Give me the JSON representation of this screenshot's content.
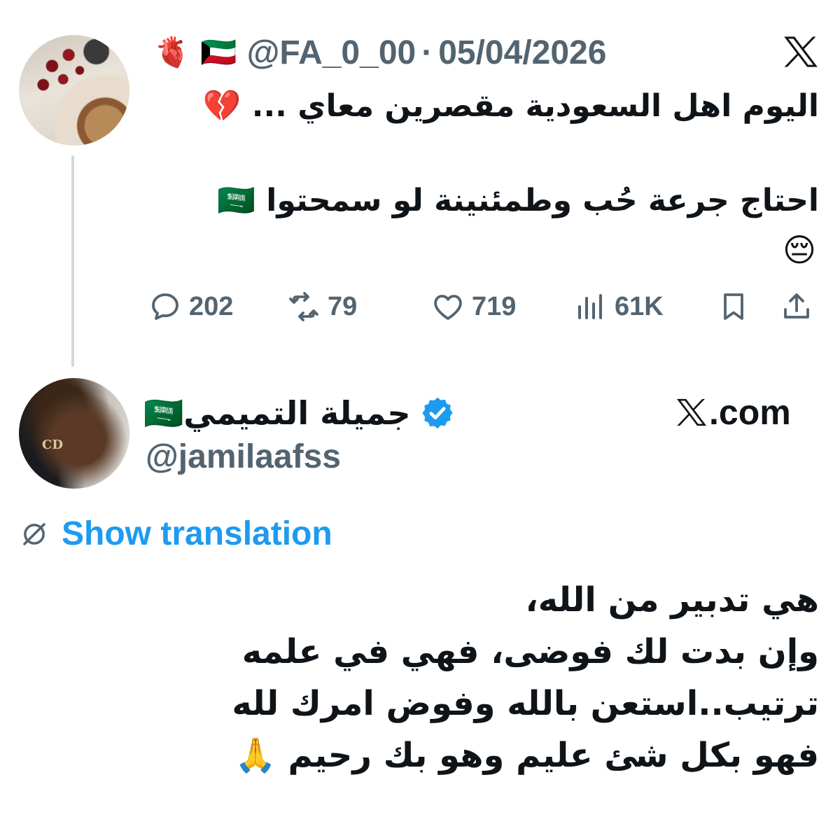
{
  "tweet1": {
    "header_emojis": [
      "🫀",
      "🇰🇼"
    ],
    "handle": "@FA_0_00",
    "separator": "·",
    "date": "05/04/2026",
    "line1": "اليوم اهل السعودية مقصرين معاي ... 💔",
    "line2": "احتاج جرعة حُب وطمئنينة لو سمحتوا 🇸🇦",
    "line3": "😔",
    "actions": {
      "replies": "202",
      "reposts": "79",
      "likes": "719",
      "views": "61K"
    }
  },
  "tweet2": {
    "display_name": "جميلة التميمي🇸🇦",
    "handle": "@jamilaafss",
    "site": ".com",
    "show_translation": "Show translation",
    "avatar_mark": "CD",
    "lines": [
      "هي تدبير من الله،",
      "وإن بدت لك فوضى، فهي في علمه",
      "ترتيب..استعن بالله وفوض امرك لله",
      "فهو بكل شئ عليم وهو بك رحيم 🙏"
    ]
  },
  "colors": {
    "text": "#0f1419",
    "muted": "#536471",
    "link": "#1d9bf0",
    "thread_line": "#cfd9de"
  },
  "icons": [
    "x-logo-icon",
    "reply-icon",
    "repost-icon",
    "like-icon",
    "views-icon",
    "bookmark-icon",
    "share-icon",
    "verified-badge-icon",
    "translate-icon"
  ]
}
